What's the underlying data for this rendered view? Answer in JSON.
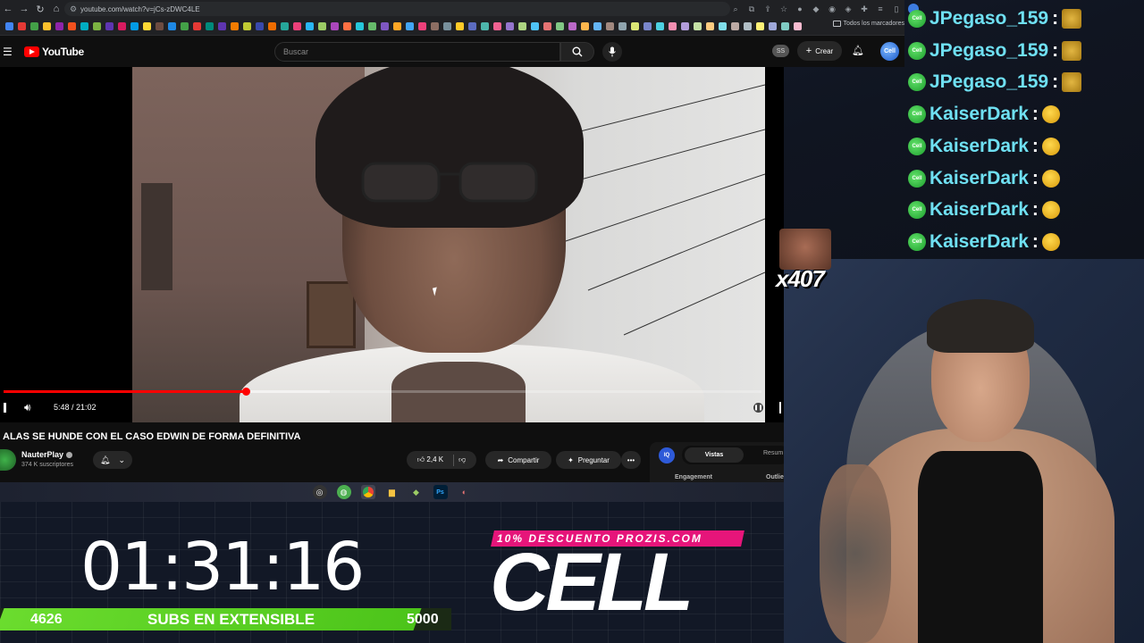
{
  "browser": {
    "url": "youtube.com/watch?v=jCs-zDWC4LE",
    "bookmarks_folder": "Todos los marcadores",
    "bookmark_colors": [
      "#4285f4",
      "#e53935",
      "#43a047",
      "#fbc02d",
      "#8e24aa",
      "#f4511e",
      "#00acc1",
      "#7cb342",
      "#5e35b1",
      "#d81b60",
      "#039be5",
      "#fdd835",
      "#6d4c41",
      "#1e88e5",
      "#43a047",
      "#e53935",
      "#00897b",
      "#5e35b1",
      "#f57c00",
      "#c0ca33",
      "#3949ab",
      "#ef6c00",
      "#26a69a",
      "#ec407a",
      "#29b6f6",
      "#9ccc65",
      "#ab47bc",
      "#ff7043",
      "#26c6da",
      "#66bb6a",
      "#7e57c2",
      "#ffa726",
      "#42a5f5",
      "#ec407a",
      "#8d6e63",
      "#78909c",
      "#ffca28",
      "#5c6bc0",
      "#4db6ac",
      "#f06292",
      "#9575cd",
      "#aed581",
      "#4fc3f7",
      "#e57373",
      "#81c784",
      "#ba68c8",
      "#ffb74d",
      "#64b5f6",
      "#a1887f",
      "#90a4ae",
      "#dce775",
      "#7986cb",
      "#4dd0e1",
      "#f48fb1",
      "#b39ddb",
      "#c5e1a5",
      "#ffcc80",
      "#80deea",
      "#bcaaa4",
      "#b0bec5",
      "#fff176",
      "#9fa8da",
      "#80cbc4",
      "#f8bbd0",
      "#d1c4e9",
      "#e6ee9c",
      "#ffe082",
      "#81d4fa",
      "#ce93d8",
      "#ff8a65",
      "#4db6ac",
      "#aed581"
    ]
  },
  "youtube": {
    "logo_text": "YouTube",
    "search_placeholder": "Buscar",
    "ss_badge": "SS",
    "create_label": "Crear",
    "avatar_text": "Cell"
  },
  "player": {
    "current_time": "5:48",
    "duration": "21:02",
    "time_display": "5:48 / 21:02",
    "progress_fraction": 0.32,
    "buffer_end_fraction": 0.43
  },
  "video": {
    "title": "ALAS SE HUNDE CON EL CASO EDWIN DE FORMA DEFINITIVA",
    "channel_name": "NauterPlay",
    "subscribers": "374 K suscriptores",
    "likes": "2,4 K",
    "share_label": "Compartir",
    "ask_label": "Preguntar",
    "more_label": "•••"
  },
  "panel": {
    "badge": "IQ",
    "tab_active": "Vistas",
    "tab_other": "Resum",
    "engagement_label": "Engagement",
    "outlier_label": "Outlie"
  },
  "overlay": {
    "timer": "01:31:16",
    "subs_current": "4626",
    "subs_label": "SUBS EN EXTENSIBLE",
    "subs_goal": "5000",
    "subs_fraction": 0.925,
    "promo": "10% DESCUENTO PROZIS.COM",
    "brand": "CELL",
    "meme_count": "x407"
  },
  "chat": {
    "messages": [
      {
        "user": "JPegaso_159",
        "emote": "emote-dog"
      },
      {
        "user": "JPegaso_159",
        "emote": "emote-dog"
      },
      {
        "user": "JPegaso_159",
        "emote": "emote-dog"
      },
      {
        "user": "KaiserDark",
        "emote": "emote-laugh"
      },
      {
        "user": "KaiserDark",
        "emote": "emote-laugh"
      },
      {
        "user": "KaiserDark",
        "emote": "emote-laugh"
      },
      {
        "user": "KaiserDark",
        "emote": "emote-laugh"
      },
      {
        "user": "KaiserDark",
        "emote": "emote-laugh"
      }
    ],
    "badge_text": "Cell",
    "colon": ":"
  },
  "colors": {
    "chat_name": "#6fe0f2",
    "progress": "#ff0000",
    "subs_bar": "#6bdc2e",
    "promo": "#e6157a"
  }
}
